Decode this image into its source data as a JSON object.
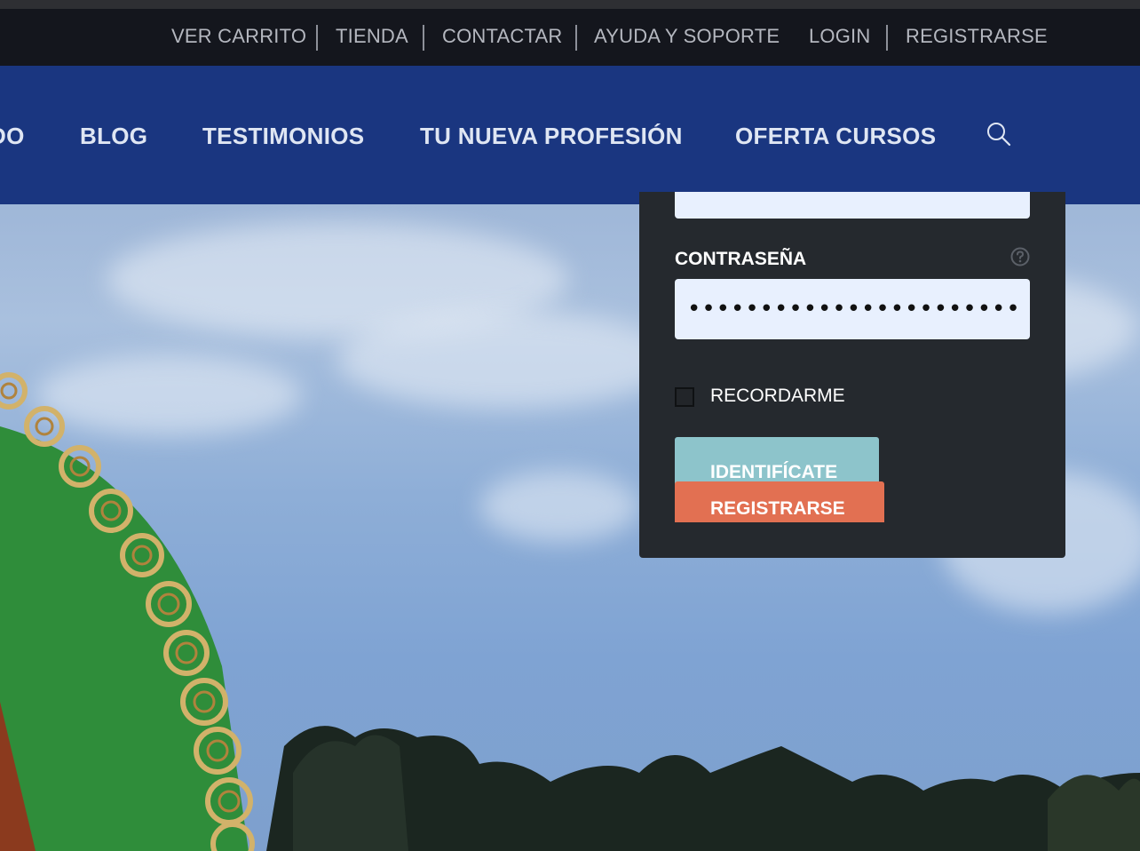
{
  "topbar": {
    "links": [
      "VER CARRITO",
      "TIENDA",
      "CONTACTAR",
      "AYUDA Y SOPORTE",
      "LOGIN",
      "REGISTRARSE"
    ]
  },
  "mainnav": {
    "items": [
      "DO",
      "BLOG",
      "TESTIMONIOS",
      "TU NUEVA PROFESIÓN",
      "OFERTA CURSOS"
    ],
    "search_icon": "search-icon"
  },
  "login": {
    "password_label": "CONTRASEÑA",
    "password_value": "••••••••••••••••••••••••",
    "remember_label": "RECORDARME",
    "login_button": "IDENTIFÍCATE",
    "register_button": "REGISTRARSE",
    "help_icon": "question-circle-icon"
  },
  "colors": {
    "topbar_bg": "#14161d",
    "nav_bg": "#1a3680",
    "panel_bg": "#25292e",
    "login_button": "#8dc4cb",
    "register_button": "#e27052",
    "input_bg": "#e8f0fe"
  }
}
